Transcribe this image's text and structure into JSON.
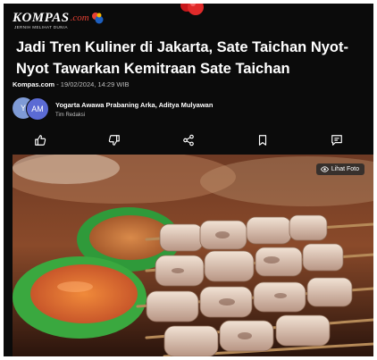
{
  "brand": {
    "name": "KOMPAS",
    "suffix": ".com",
    "tagline": "JERNIH MELIHAT DUNIA",
    "accent": "#e64033"
  },
  "article": {
    "title": "Jadi Tren Kuliner di Jakarta, Sate Taichan Nyot-Nyot Tawarkan Kemitraan Sate Taichan",
    "source": "Kompas.com",
    "date": " - 19/02/2024, 14:29 WIB",
    "authors": "Yogarta Awawa Prabaning Arka, Aditya Mulyawan",
    "team": "Tim Redaksi",
    "avatar_initials": [
      "Y",
      "AM"
    ]
  },
  "actions": [
    "like-icon",
    "dislike-icon",
    "share-icon",
    "bookmark-icon",
    "comment-icon"
  ],
  "photo": {
    "button_label": "Lihat Foto"
  }
}
